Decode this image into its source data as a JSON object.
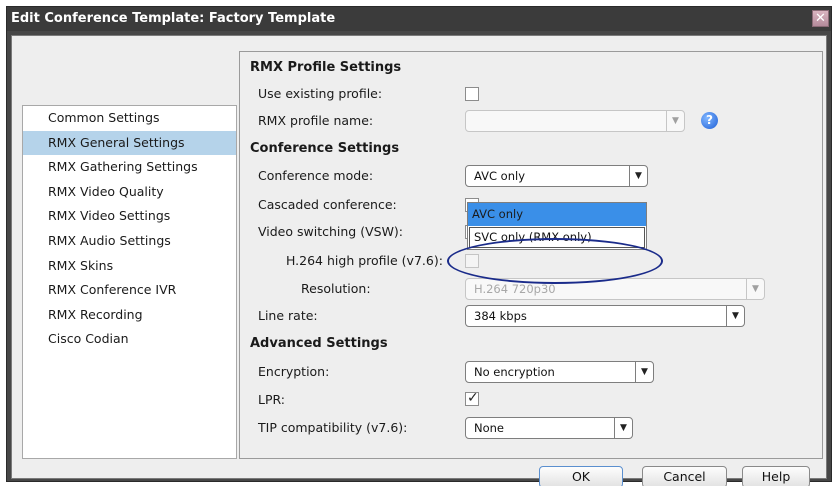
{
  "window": {
    "title": "Edit Conference Template: Factory Template",
    "close_symbol": "✕"
  },
  "sidebar": {
    "items": [
      {
        "label": "Common Settings",
        "selected": false
      },
      {
        "label": "RMX General Settings",
        "selected": true
      },
      {
        "label": "RMX Gathering Settings",
        "selected": false
      },
      {
        "label": "RMX Video Quality",
        "selected": false
      },
      {
        "label": "RMX Video Settings",
        "selected": false
      },
      {
        "label": "RMX Audio Settings",
        "selected": false
      },
      {
        "label": "RMX Skins",
        "selected": false
      },
      {
        "label": "RMX Conference IVR",
        "selected": false
      },
      {
        "label": "RMX Recording",
        "selected": false
      },
      {
        "label": "Cisco Codian",
        "selected": false
      }
    ]
  },
  "rmx_profile": {
    "title": "RMX Profile Settings",
    "use_existing_label": "Use existing profile:",
    "use_existing_checked": false,
    "profile_name_label": "RMX profile name:",
    "profile_name_value": "",
    "help_symbol": "?"
  },
  "conference": {
    "title": "Conference Settings",
    "mode_label": "Conference mode:",
    "mode_value": "AVC only",
    "mode_options": [
      "AVC only",
      "SVC only (RMX only)"
    ],
    "cascaded_label": "Cascaded conference:",
    "vsw_label": "Video switching (VSW):",
    "h264_label": "H.264 high profile (v7.6):",
    "resolution_label": "Resolution:",
    "resolution_value": "H.264 720p30",
    "line_rate_label": "Line rate:",
    "line_rate_value": "384 kbps"
  },
  "advanced": {
    "title": "Advanced Settings",
    "encryption_label": "Encryption:",
    "encryption_value": "No encryption",
    "lpr_label": "LPR:",
    "lpr_checked": true,
    "tip_label": "TIP compatibility (v7.6):",
    "tip_value": "None"
  },
  "symbols": {
    "dropdown_arrow": "▼",
    "check": "✓"
  },
  "buttons": {
    "ok": "OK",
    "cancel": "Cancel",
    "help": "Help"
  }
}
